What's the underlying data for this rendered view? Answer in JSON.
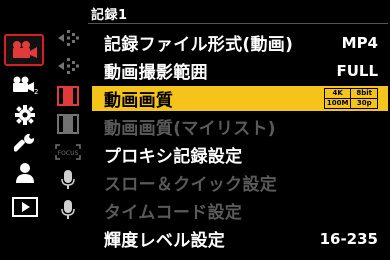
{
  "header": {
    "title": "記録1"
  },
  "categories": [
    {
      "icon": "video-camera-icon",
      "active": true
    },
    {
      "icon": "video-camera-2-icon",
      "sub": "2"
    },
    {
      "icon": "gear-icon"
    },
    {
      "icon": "wrench-icon"
    },
    {
      "icon": "person-icon"
    },
    {
      "icon": "playback-icon"
    }
  ],
  "sub_icons": [
    {
      "icon": "focus-arrows-icon"
    },
    {
      "icon": "focus-arrows-icon"
    },
    {
      "icon": "film-icon",
      "active": true
    },
    {
      "icon": "film-icon"
    },
    {
      "icon": "focus-box-icon",
      "text": "FOCUS"
    },
    {
      "icon": "microphone-icon"
    },
    {
      "icon": "microphone-icon"
    }
  ],
  "menu": [
    {
      "label": "記録ファイル形式(動画)",
      "value": "MP4",
      "state": "normal"
    },
    {
      "label": "動画撮影範囲",
      "value": "FULL",
      "state": "normal"
    },
    {
      "label": "動画画質",
      "value": "",
      "state": "selected",
      "badge": [
        "4K",
        "8bit",
        "100M",
        "30p"
      ]
    },
    {
      "label": "動画画質(マイリスト)",
      "value": "",
      "state": "disabled"
    },
    {
      "label": "プロキシ記録設定",
      "value": "",
      "state": "normal"
    },
    {
      "label": "スロー＆クイック設定",
      "value": "",
      "state": "disabled"
    },
    {
      "label": "タイムコード設定",
      "value": "",
      "state": "disabled"
    },
    {
      "label": "輝度レベル設定",
      "value": "16-235",
      "state": "normal"
    }
  ],
  "colors": {
    "selected_bg": "#f4c41b",
    "active_border": "#d81e1e",
    "icon_red": "#e23a3a",
    "disabled_text": "#5a5a5a"
  }
}
